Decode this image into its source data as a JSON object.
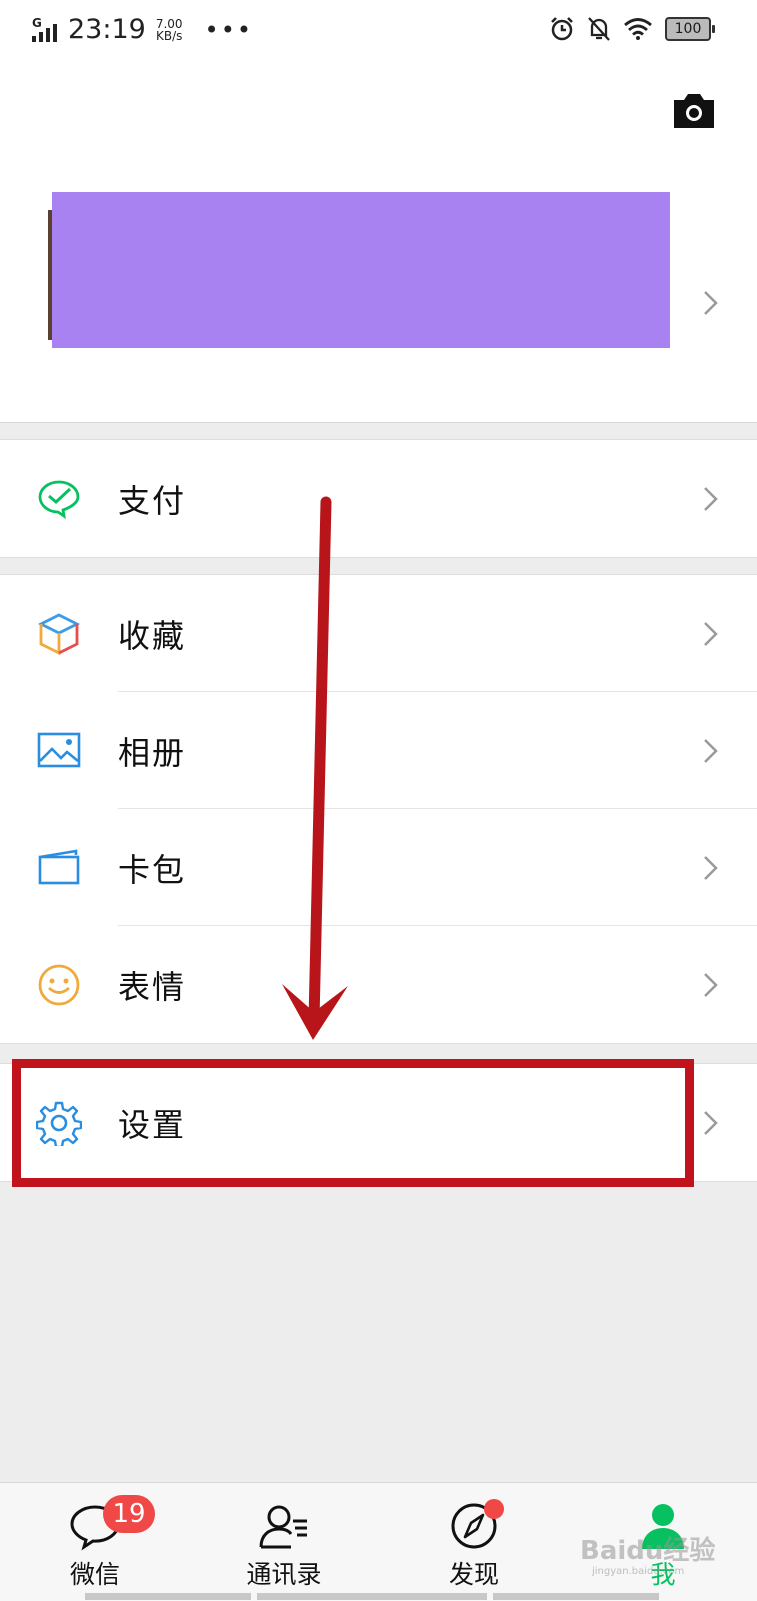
{
  "status_bar": {
    "network": "G",
    "time": "23:19",
    "speed_value": "7.00",
    "speed_unit": "KB/s",
    "more": "•••",
    "battery": "100"
  },
  "profile": {
    "redacted_color": "#a982f2"
  },
  "menu": {
    "pay": {
      "label": "支付",
      "icon": "wechat-pay-icon"
    },
    "favorites": {
      "label": "收藏",
      "icon": "favorites-cube-icon"
    },
    "album": {
      "label": "相册",
      "icon": "album-picture-icon"
    },
    "cards": {
      "label": "卡包",
      "icon": "card-wallet-icon"
    },
    "stickers": {
      "label": "表情",
      "icon": "smiley-icon"
    },
    "settings": {
      "label": "设置",
      "icon": "gear-icon"
    }
  },
  "tabbar": {
    "chats": {
      "label": "微信",
      "badge": "19"
    },
    "contacts": {
      "label": "通讯录"
    },
    "discover": {
      "label": "发现"
    },
    "me": {
      "label": "我"
    }
  },
  "annotation": {
    "highlight_color": "#c0131b"
  },
  "watermark": {
    "text": "Baidu经验",
    "sub": "jingyan.baidu.com"
  },
  "colors": {
    "accent_green": "#07c160",
    "badge_red": "#f04747",
    "background": "#ededed"
  }
}
